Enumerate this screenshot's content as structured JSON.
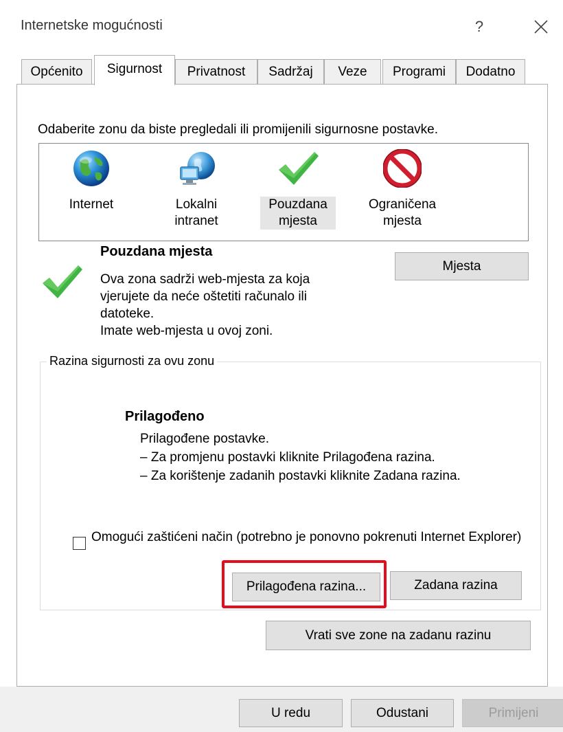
{
  "window": {
    "title": "Internetske mogućnosti",
    "help_label": "?"
  },
  "tabs": [
    {
      "label": "Općenito",
      "active": false
    },
    {
      "label": "Sigurnost",
      "active": true
    },
    {
      "label": "Privatnost",
      "active": false
    },
    {
      "label": "Sadržaj",
      "active": false
    },
    {
      "label": "Veze",
      "active": false
    },
    {
      "label": "Programi",
      "active": false
    },
    {
      "label": "Dodatno",
      "active": false
    }
  ],
  "security": {
    "zone_instruction": "Odaberite zonu da biste pregledali ili promijenili sigurnosne postavke.",
    "zones": [
      {
        "label_line1": "Internet",
        "label_line2": "",
        "icon": "globe-icon",
        "selected": false
      },
      {
        "label_line1": "Lokalni",
        "label_line2": "intranet",
        "icon": "network-globe-icon",
        "selected": false
      },
      {
        "label_line1": "Pouzdana",
        "label_line2": "mjesta",
        "icon": "checkmark-icon",
        "selected": true
      },
      {
        "label_line1": "Ograničena",
        "label_line2": "mjesta",
        "icon": "blocked-icon",
        "selected": false
      }
    ],
    "selected_zone": {
      "title": "Pouzdana mjesta",
      "desc_lines": [
        "Ova zona sadrži web-mjesta za koja",
        "vjerujete da neće oštetiti računalo ili",
        "datoteke.",
        "Imate web-mjesta u ovoj zoni."
      ],
      "sites_button": "Mjesta"
    },
    "level_group": {
      "legend": "Razina sigurnosti za ovu zonu",
      "level_name": "Prilagođeno",
      "desc_lines": [
        "Prilagođene postavke.",
        "– Za promjenu postavki kliknite Prilagođena razina.",
        "– Za korištenje zadanih postavki kliknite Zadana razina."
      ],
      "protected_mode_label": "Omogući zaštićeni način (potrebno je ponovno pokrenuti Internet Explorer)",
      "protected_mode_checked": false,
      "custom_level_button": "Prilagođena razina...",
      "default_level_button": "Zadana razina"
    },
    "reset_all_button": "Vrati sve zone na zadanu razinu"
  },
  "footer": {
    "ok": "U redu",
    "cancel": "Odustani",
    "apply": "Primijeni"
  },
  "colors": {
    "highlight": "#e30d1b",
    "check_green": "#3fb544"
  }
}
